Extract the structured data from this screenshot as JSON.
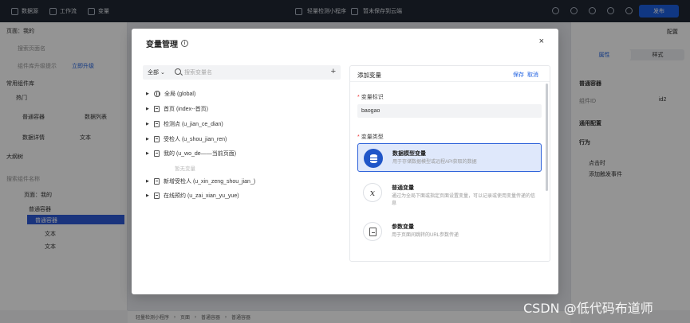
{
  "ide": {
    "tabs": [
      "数据源",
      "工作流",
      "变量"
    ],
    "app_title": "轻量检测小程序",
    "save_status": "暂未保存到云端",
    "publish_label": "发布",
    "left_panel": {
      "page_label": "页面：我的",
      "search_placeholder": "搜索页面名",
      "hint": "组件库升级提示",
      "upgrade_link": "立即升级",
      "section_components": "常用组件库",
      "hot": "热门",
      "items": [
        "普通容器",
        "数据列表",
        "数据详情",
        "文本"
      ],
      "outline_title": "大纲树",
      "outline_search": "搜索组件名称",
      "outline_items": [
        "页面：我的",
        "普通容器",
        "普通容器",
        "文本",
        "文本"
      ]
    },
    "right_panel": {
      "tabs": [
        "属性",
        "样式"
      ],
      "component": "普通容器",
      "component_id": "组件ID",
      "id_value": "id2",
      "general_config": "通用配置",
      "behavior": "行为",
      "click": "点击时",
      "add_event": "添加触发事件",
      "settings_link": "配置"
    },
    "breadcrumb": [
      "轻量检测小程序",
      "页面",
      "普通容器",
      "普通容器"
    ]
  },
  "modal": {
    "title": "变量管理",
    "close": "×",
    "scope": "全部",
    "search_placeholder": "搜索变量名",
    "add": "+",
    "tree": [
      {
        "label": "全局 (global)",
        "icon": "globe-icon"
      },
      {
        "label": "首页 (index--首页)",
        "icon": "page-icon"
      },
      {
        "label": "检测点 (u_jian_ce_dian)",
        "icon": "page-icon"
      },
      {
        "label": "受检人 (u_shou_jian_ren)",
        "icon": "page-icon"
      },
      {
        "label": "我的 (u_wo_de——当前页面)",
        "icon": "page-icon"
      },
      {
        "label": "新增受检人 (u_xin_zeng_shou_jian_)",
        "icon": "page-icon"
      },
      {
        "label": "在线预约 (u_zai_xian_yu_yue)",
        "icon": "page-icon"
      }
    ],
    "empty_hint": "暂无变量",
    "form": {
      "title": "添加变量",
      "save": "保存",
      "cancel": "取消",
      "id_label": "变量标识",
      "id_value": "baogao",
      "type_label": "变量类型",
      "types": [
        {
          "name": "数据模型变量",
          "desc": "用于存储数据模型或远程API获取的数据",
          "icon": "database-icon"
        },
        {
          "name": "普通变量",
          "desc": "通过为全局下面或指定页面设置变量，可以记录或使用变量传递的信息",
          "icon": "variable-x-icon"
        },
        {
          "name": "参数变量",
          "desc": "用于页面间跳转的URL参数传递",
          "icon": "document-icon"
        }
      ]
    }
  },
  "watermark": "CSDN @低代码布道师"
}
